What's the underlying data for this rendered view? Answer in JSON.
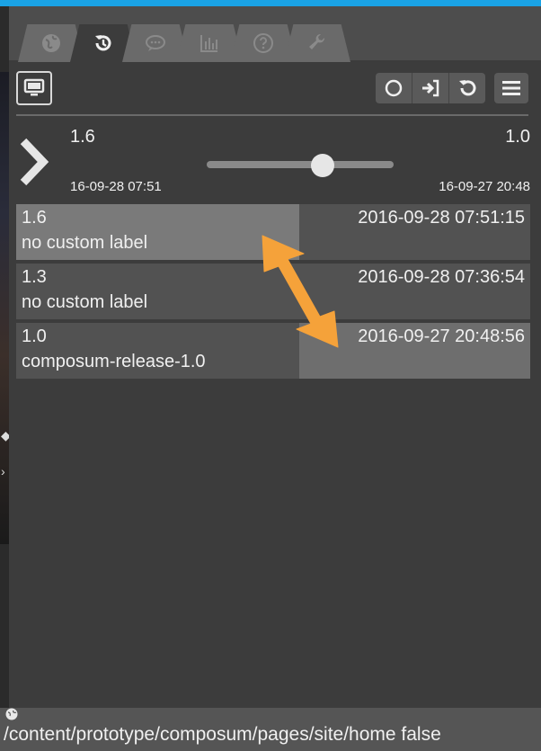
{
  "tabs": [
    {
      "id": "globe",
      "icon": "globe-icon",
      "active": false
    },
    {
      "id": "history",
      "icon": "history-icon",
      "active": true
    },
    {
      "id": "comments",
      "icon": "comment-icon",
      "active": false
    },
    {
      "id": "chart",
      "icon": "bar-chart-icon",
      "active": false
    },
    {
      "id": "help",
      "icon": "help-icon",
      "active": false
    },
    {
      "id": "tools",
      "icon": "wrench-icon",
      "active": false
    }
  ],
  "toolbar": {
    "view_icon": "monitor-icon",
    "group_icons": [
      "circle-icon",
      "sign-in-icon",
      "undo-icon"
    ],
    "menu_icon": "menu-icon"
  },
  "compare": {
    "left_version": "1.6",
    "right_version": "1.0",
    "left_date": "16-09-28 07:51",
    "right_date": "16-09-27 20:48",
    "slider_position": 0.72
  },
  "versions": [
    {
      "version": "1.6",
      "label": "no custom label",
      "timestamp": "2016-09-28 07:51:15",
      "selected": "left"
    },
    {
      "version": "1.3",
      "label": "no custom label",
      "timestamp": "2016-09-28 07:36:54",
      "selected": ""
    },
    {
      "version": "1.0",
      "label": "composum-release-1.0",
      "timestamp": "2016-09-27 20:48:56",
      "selected": "right"
    }
  ],
  "footer": {
    "path": "/content/prototype/composum/pages/site/home false"
  },
  "colors": {
    "accent": "#1aa3e6",
    "arrow": "#f5a23a"
  }
}
